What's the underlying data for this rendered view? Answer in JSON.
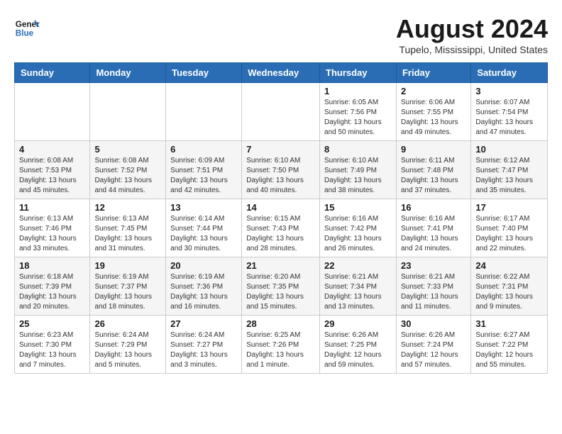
{
  "header": {
    "logo_line1": "General",
    "logo_line2": "Blue",
    "month_title": "August 2024",
    "location": "Tupelo, Mississippi, United States"
  },
  "days_of_week": [
    "Sunday",
    "Monday",
    "Tuesday",
    "Wednesday",
    "Thursday",
    "Friday",
    "Saturday"
  ],
  "weeks": [
    [
      {
        "num": "",
        "info": ""
      },
      {
        "num": "",
        "info": ""
      },
      {
        "num": "",
        "info": ""
      },
      {
        "num": "",
        "info": ""
      },
      {
        "num": "1",
        "info": "Sunrise: 6:05 AM\nSunset: 7:56 PM\nDaylight: 13 hours\nand 50 minutes."
      },
      {
        "num": "2",
        "info": "Sunrise: 6:06 AM\nSunset: 7:55 PM\nDaylight: 13 hours\nand 49 minutes."
      },
      {
        "num": "3",
        "info": "Sunrise: 6:07 AM\nSunset: 7:54 PM\nDaylight: 13 hours\nand 47 minutes."
      }
    ],
    [
      {
        "num": "4",
        "info": "Sunrise: 6:08 AM\nSunset: 7:53 PM\nDaylight: 13 hours\nand 45 minutes."
      },
      {
        "num": "5",
        "info": "Sunrise: 6:08 AM\nSunset: 7:52 PM\nDaylight: 13 hours\nand 44 minutes."
      },
      {
        "num": "6",
        "info": "Sunrise: 6:09 AM\nSunset: 7:51 PM\nDaylight: 13 hours\nand 42 minutes."
      },
      {
        "num": "7",
        "info": "Sunrise: 6:10 AM\nSunset: 7:50 PM\nDaylight: 13 hours\nand 40 minutes."
      },
      {
        "num": "8",
        "info": "Sunrise: 6:10 AM\nSunset: 7:49 PM\nDaylight: 13 hours\nand 38 minutes."
      },
      {
        "num": "9",
        "info": "Sunrise: 6:11 AM\nSunset: 7:48 PM\nDaylight: 13 hours\nand 37 minutes."
      },
      {
        "num": "10",
        "info": "Sunrise: 6:12 AM\nSunset: 7:47 PM\nDaylight: 13 hours\nand 35 minutes."
      }
    ],
    [
      {
        "num": "11",
        "info": "Sunrise: 6:13 AM\nSunset: 7:46 PM\nDaylight: 13 hours\nand 33 minutes."
      },
      {
        "num": "12",
        "info": "Sunrise: 6:13 AM\nSunset: 7:45 PM\nDaylight: 13 hours\nand 31 minutes."
      },
      {
        "num": "13",
        "info": "Sunrise: 6:14 AM\nSunset: 7:44 PM\nDaylight: 13 hours\nand 30 minutes."
      },
      {
        "num": "14",
        "info": "Sunrise: 6:15 AM\nSunset: 7:43 PM\nDaylight: 13 hours\nand 28 minutes."
      },
      {
        "num": "15",
        "info": "Sunrise: 6:16 AM\nSunset: 7:42 PM\nDaylight: 13 hours\nand 26 minutes."
      },
      {
        "num": "16",
        "info": "Sunrise: 6:16 AM\nSunset: 7:41 PM\nDaylight: 13 hours\nand 24 minutes."
      },
      {
        "num": "17",
        "info": "Sunrise: 6:17 AM\nSunset: 7:40 PM\nDaylight: 13 hours\nand 22 minutes."
      }
    ],
    [
      {
        "num": "18",
        "info": "Sunrise: 6:18 AM\nSunset: 7:39 PM\nDaylight: 13 hours\nand 20 minutes."
      },
      {
        "num": "19",
        "info": "Sunrise: 6:19 AM\nSunset: 7:37 PM\nDaylight: 13 hours\nand 18 minutes."
      },
      {
        "num": "20",
        "info": "Sunrise: 6:19 AM\nSunset: 7:36 PM\nDaylight: 13 hours\nand 16 minutes."
      },
      {
        "num": "21",
        "info": "Sunrise: 6:20 AM\nSunset: 7:35 PM\nDaylight: 13 hours\nand 15 minutes."
      },
      {
        "num": "22",
        "info": "Sunrise: 6:21 AM\nSunset: 7:34 PM\nDaylight: 13 hours\nand 13 minutes."
      },
      {
        "num": "23",
        "info": "Sunrise: 6:21 AM\nSunset: 7:33 PM\nDaylight: 13 hours\nand 11 minutes."
      },
      {
        "num": "24",
        "info": "Sunrise: 6:22 AM\nSunset: 7:31 PM\nDaylight: 13 hours\nand 9 minutes."
      }
    ],
    [
      {
        "num": "25",
        "info": "Sunrise: 6:23 AM\nSunset: 7:30 PM\nDaylight: 13 hours\nand 7 minutes."
      },
      {
        "num": "26",
        "info": "Sunrise: 6:24 AM\nSunset: 7:29 PM\nDaylight: 13 hours\nand 5 minutes."
      },
      {
        "num": "27",
        "info": "Sunrise: 6:24 AM\nSunset: 7:27 PM\nDaylight: 13 hours\nand 3 minutes."
      },
      {
        "num": "28",
        "info": "Sunrise: 6:25 AM\nSunset: 7:26 PM\nDaylight: 13 hours\nand 1 minute."
      },
      {
        "num": "29",
        "info": "Sunrise: 6:26 AM\nSunset: 7:25 PM\nDaylight: 12 hours\nand 59 minutes."
      },
      {
        "num": "30",
        "info": "Sunrise: 6:26 AM\nSunset: 7:24 PM\nDaylight: 12 hours\nand 57 minutes."
      },
      {
        "num": "31",
        "info": "Sunrise: 6:27 AM\nSunset: 7:22 PM\nDaylight: 12 hours\nand 55 minutes."
      }
    ]
  ]
}
